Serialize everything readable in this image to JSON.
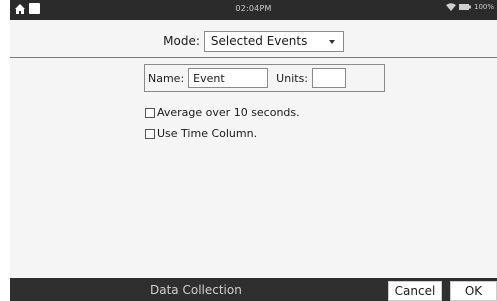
{
  "statusbar": {
    "time": "02:04PM",
    "battery": "100%"
  },
  "mode": {
    "label": "Mode:",
    "selected": "Selected Events"
  },
  "fields": {
    "name_label": "Name:",
    "name_value": "Event",
    "units_label": "Units:",
    "units_value": ""
  },
  "options": {
    "average_label": "Average over 10 seconds.",
    "time_column_label": "Use Time Column."
  },
  "footer": {
    "title": "Data Collection",
    "cancel_label": "Cancel",
    "ok_label": "OK"
  }
}
